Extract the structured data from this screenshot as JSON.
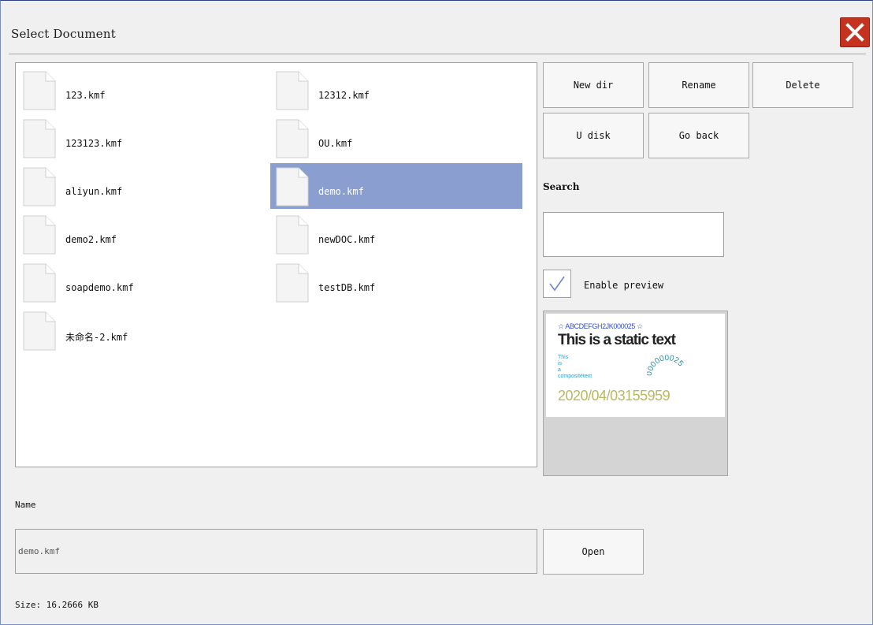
{
  "window": {
    "title": "Select Document"
  },
  "files": [
    {
      "name": "123.kmf",
      "selected": false
    },
    {
      "name": "12312.kmf",
      "selected": false
    },
    {
      "name": "123123.kmf",
      "selected": false
    },
    {
      "name": "OU.kmf",
      "selected": false
    },
    {
      "name": "aliyun.kmf",
      "selected": false
    },
    {
      "name": "demo.kmf",
      "selected": true
    },
    {
      "name": "demo2.kmf",
      "selected": false
    },
    {
      "name": "newDOC.kmf",
      "selected": false
    },
    {
      "name": "soapdemo.kmf",
      "selected": false
    },
    {
      "name": "testDB.kmf",
      "selected": false
    },
    {
      "name": "未命名-2.kmf",
      "selected": false
    }
  ],
  "actions": {
    "new_dir": "New dir",
    "rename": "Rename",
    "delete": "Delete",
    "u_disk": "U disk",
    "go_back": "Go back"
  },
  "search": {
    "label": "Search",
    "value": ""
  },
  "preview_toggle": {
    "label": "Enable preview",
    "checked": true
  },
  "preview": {
    "barcode_text": "☆ ABCDEFGH2JK000025 ☆",
    "static_text": "This is a static text",
    "composite_lines": [
      "This",
      "is",
      "a",
      "compositetext"
    ],
    "arc_text": "000000025",
    "date_text": "2020/04/03155959"
  },
  "name_field": {
    "label": "Name",
    "value": "demo.kmf"
  },
  "open_button": "Open",
  "size_text": "Size:  16.2666 KB",
  "colors": {
    "selection": "#8a9fd0",
    "close_red": "#c5321f",
    "barcode_blue": "#2e4ce0",
    "composite_cyan": "#2aa3d8",
    "date_olive": "#b8b862"
  }
}
